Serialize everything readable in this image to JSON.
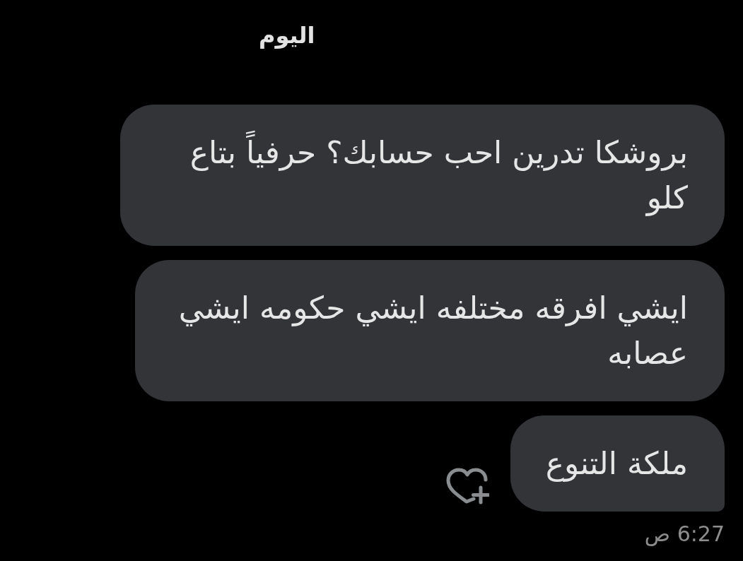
{
  "date_header": "اليوم",
  "messages": [
    {
      "text": "بروشكا تدرين احب حسابك؟ حرفياً بتاع كلو"
    },
    {
      "text": "ايشي افرقه مختلفه ايشي حكومه ايشي عصابه"
    },
    {
      "text": "ملكة التنوع"
    }
  ],
  "timestamp": "6:27 ص"
}
